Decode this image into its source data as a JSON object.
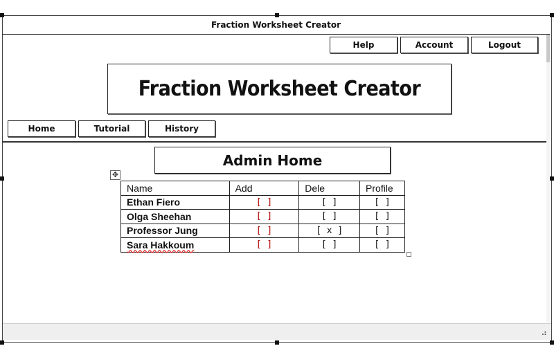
{
  "window": {
    "title": "Fraction Worksheet Creator"
  },
  "top_buttons": {
    "help": "Help",
    "account": "Account",
    "logout": "Logout"
  },
  "banner": {
    "title": "Fraction Worksheet Creator"
  },
  "nav": {
    "home": "Home",
    "tutorial": "Tutorial",
    "history": "History"
  },
  "page": {
    "heading": "Admin Home"
  },
  "table": {
    "headers": {
      "name": "Name",
      "add": "Add",
      "dele": "Dele",
      "profile": "Profile"
    },
    "rows": [
      {
        "name": "Ethan Fiero",
        "add": "[   ]",
        "dele": "[   ]",
        "profile": "[   ]"
      },
      {
        "name": "Olga Sheehan",
        "add": "[   ]",
        "dele": "[   ]",
        "profile": "[   ]"
      },
      {
        "name": "Professor Jung",
        "add": "[   ]",
        "dele": "[ x ]",
        "profile": "[   ]"
      },
      {
        "name": "Sara Hakkoum",
        "add": "[   ]",
        "dele": "[   ]",
        "profile": "[   ]"
      }
    ]
  },
  "icons": {
    "move_handle": "move-icon",
    "resize_grip": "resize-grip-icon"
  }
}
